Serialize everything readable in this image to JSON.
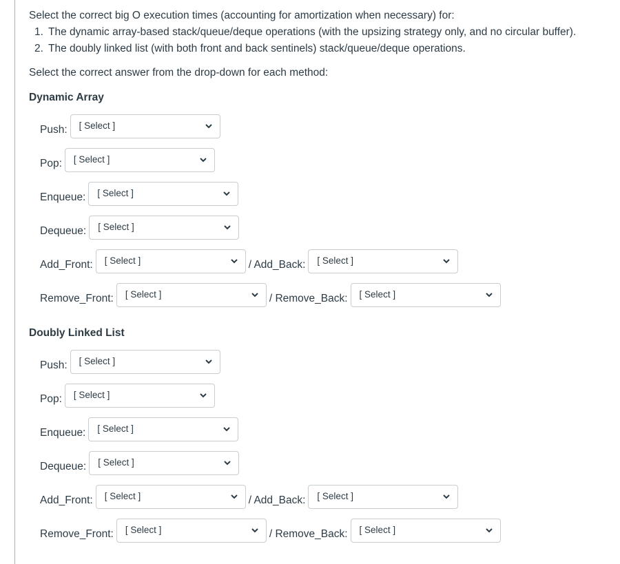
{
  "question": {
    "intro": "Select the correct big O execution times (accounting for amortization when necessary) for:",
    "items": [
      {
        "num": "1.",
        "text": "The dynamic array-based stack/queue/deque operations (with the upsizing strategy only, and no circular buffer)."
      },
      {
        "num": "2.",
        "text": "The doubly linked list (with both front and back sentinels) stack/queue/deque operations."
      }
    ],
    "instruction": "Select the correct answer from the drop-down for each method:"
  },
  "select_placeholder": "[ Select ]",
  "sections": [
    {
      "title": "Dynamic Array",
      "fields": {
        "push": {
          "label": "Push:",
          "value": "[ Select ]"
        },
        "pop": {
          "label": "Pop:",
          "value": "[ Select ]"
        },
        "enqueue": {
          "label": "Enqueue:",
          "value": "[ Select ]"
        },
        "dequeue": {
          "label": "Dequeue:",
          "value": "[ Select ]"
        },
        "add_front": {
          "label": "Add_Front:",
          "value": "[ Select ]"
        },
        "add_back": {
          "label": "/ Add_Back:",
          "value": "[ Select ]"
        },
        "remove_front": {
          "label": "Remove_Front:",
          "value": "[ Select ]"
        },
        "remove_back": {
          "label": "/ Remove_Back:",
          "value": "[ Select ]"
        }
      }
    },
    {
      "title": "Doubly Linked List",
      "fields": {
        "push": {
          "label": "Push:",
          "value": "[ Select ]"
        },
        "pop": {
          "label": "Pop:",
          "value": "[ Select ]"
        },
        "enqueue": {
          "label": "Enqueue:",
          "value": "[ Select ]"
        },
        "dequeue": {
          "label": "Dequeue:",
          "value": "[ Select ]"
        },
        "add_front": {
          "label": "Add_Front:",
          "value": "[ Select ]"
        },
        "add_back": {
          "label": "/ Add_Back:",
          "value": "[ Select ]"
        },
        "remove_front": {
          "label": "Remove_Front:",
          "value": "[ Select ]"
        },
        "remove_back": {
          "label": "/ Remove_Back:",
          "value": "[ Select ]"
        }
      }
    }
  ],
  "icons": {
    "dropdown": "chevron-down-icon"
  },
  "colors": {
    "text": "#2d3b45",
    "border": "#c7cdd1",
    "rule": "#b0b0b0"
  }
}
